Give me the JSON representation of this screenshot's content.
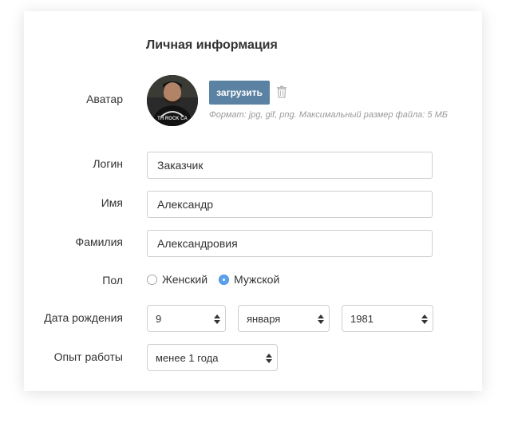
{
  "section_title": "Личная информация",
  "avatar": {
    "label": "Аватар",
    "upload_label": "загрузить",
    "hint": "Формат: jpg, gif, png. Максимальный размер файла: 5 МБ",
    "shirt_text": "TH ROCK CA"
  },
  "fields": {
    "login": {
      "label": "Логин",
      "value": "Заказчик"
    },
    "first_name": {
      "label": "Имя",
      "value": "Александр"
    },
    "last_name": {
      "label": "Фамилия",
      "value": "Александровия"
    }
  },
  "gender": {
    "label": "Пол",
    "options": [
      "Женский",
      "Мужской"
    ],
    "selected": "Мужской"
  },
  "birth_date": {
    "label": "Дата рождения",
    "day": "9",
    "month": "января",
    "year": "1981"
  },
  "experience": {
    "label": "Опыт работы",
    "value": "менее 1 года"
  },
  "colors": {
    "accent": "#5b82a3",
    "radio_checked": "#5aa1f0"
  },
  "icons": [
    "trash-icon",
    "select-arrows-icon",
    "radio-icon"
  ]
}
